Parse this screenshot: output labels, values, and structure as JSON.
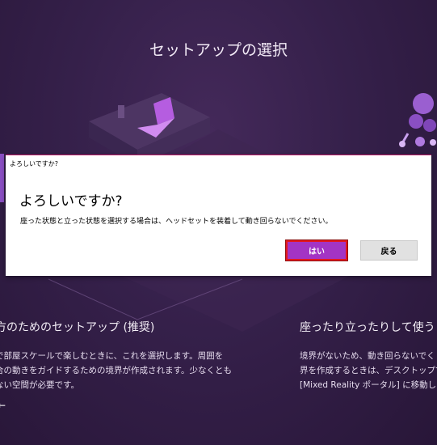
{
  "page": {
    "title": "セットアップの選択"
  },
  "options": [
    {
      "title": "方のためのセットアップ (推奨)",
      "desc_lines": [
        "で部屋スケールで楽しむときに、これを選択します。周囲を",
        "合の動きをガイドするための境界が作成されます。少なくとも",
        "ない空間が必要です。"
      ]
    },
    {
      "title": "座ったり立ったりして使うとき",
      "desc_lines": [
        "境界がないため、動き回らないでく",
        "界を作成するときは、デスクトップで",
        "[Mixed Reality ポータル] に移動しま"
      ]
    }
  ],
  "dialog": {
    "caption": "よろしいですか?",
    "heading": "よろしいですか?",
    "message": "座った状態と立った状態を選択する場合は、ヘッドセットを装着して動き回らないでください。",
    "yes_label": "はい",
    "back_label": "戻る"
  },
  "icons": {
    "back_arrow": "←"
  },
  "colors": {
    "background": "#35204a",
    "primary_button": "#a334c4",
    "focus_border": "#e3171e"
  }
}
